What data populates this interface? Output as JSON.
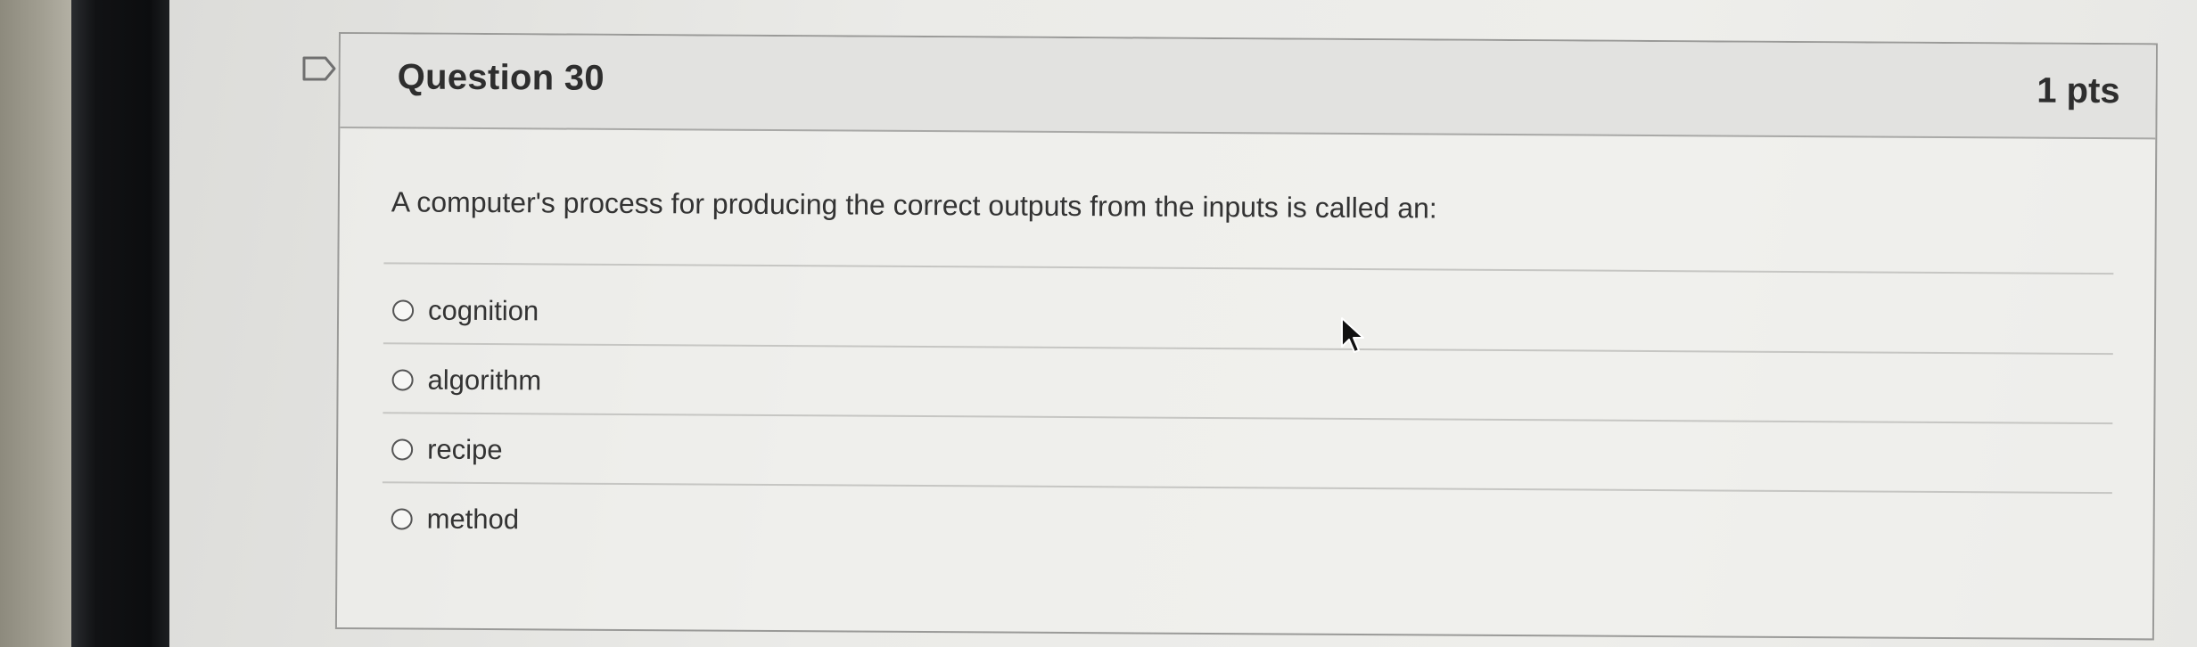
{
  "question": {
    "title": "Question 30",
    "points": "1 pts",
    "prompt": "A computer's process for producing the correct outputs from the inputs is called an:",
    "answers": [
      {
        "label": "cognition",
        "selected": false
      },
      {
        "label": "algorithm",
        "selected": false
      },
      {
        "label": "recipe",
        "selected": false
      },
      {
        "label": "method",
        "selected": false
      }
    ]
  },
  "icons": {
    "flag": "flag-icon",
    "cursor": "mouse-pointer-icon"
  },
  "colors": {
    "header_bg": "#e2e2e0",
    "text": "#333333",
    "border": "#9a9a98"
  }
}
